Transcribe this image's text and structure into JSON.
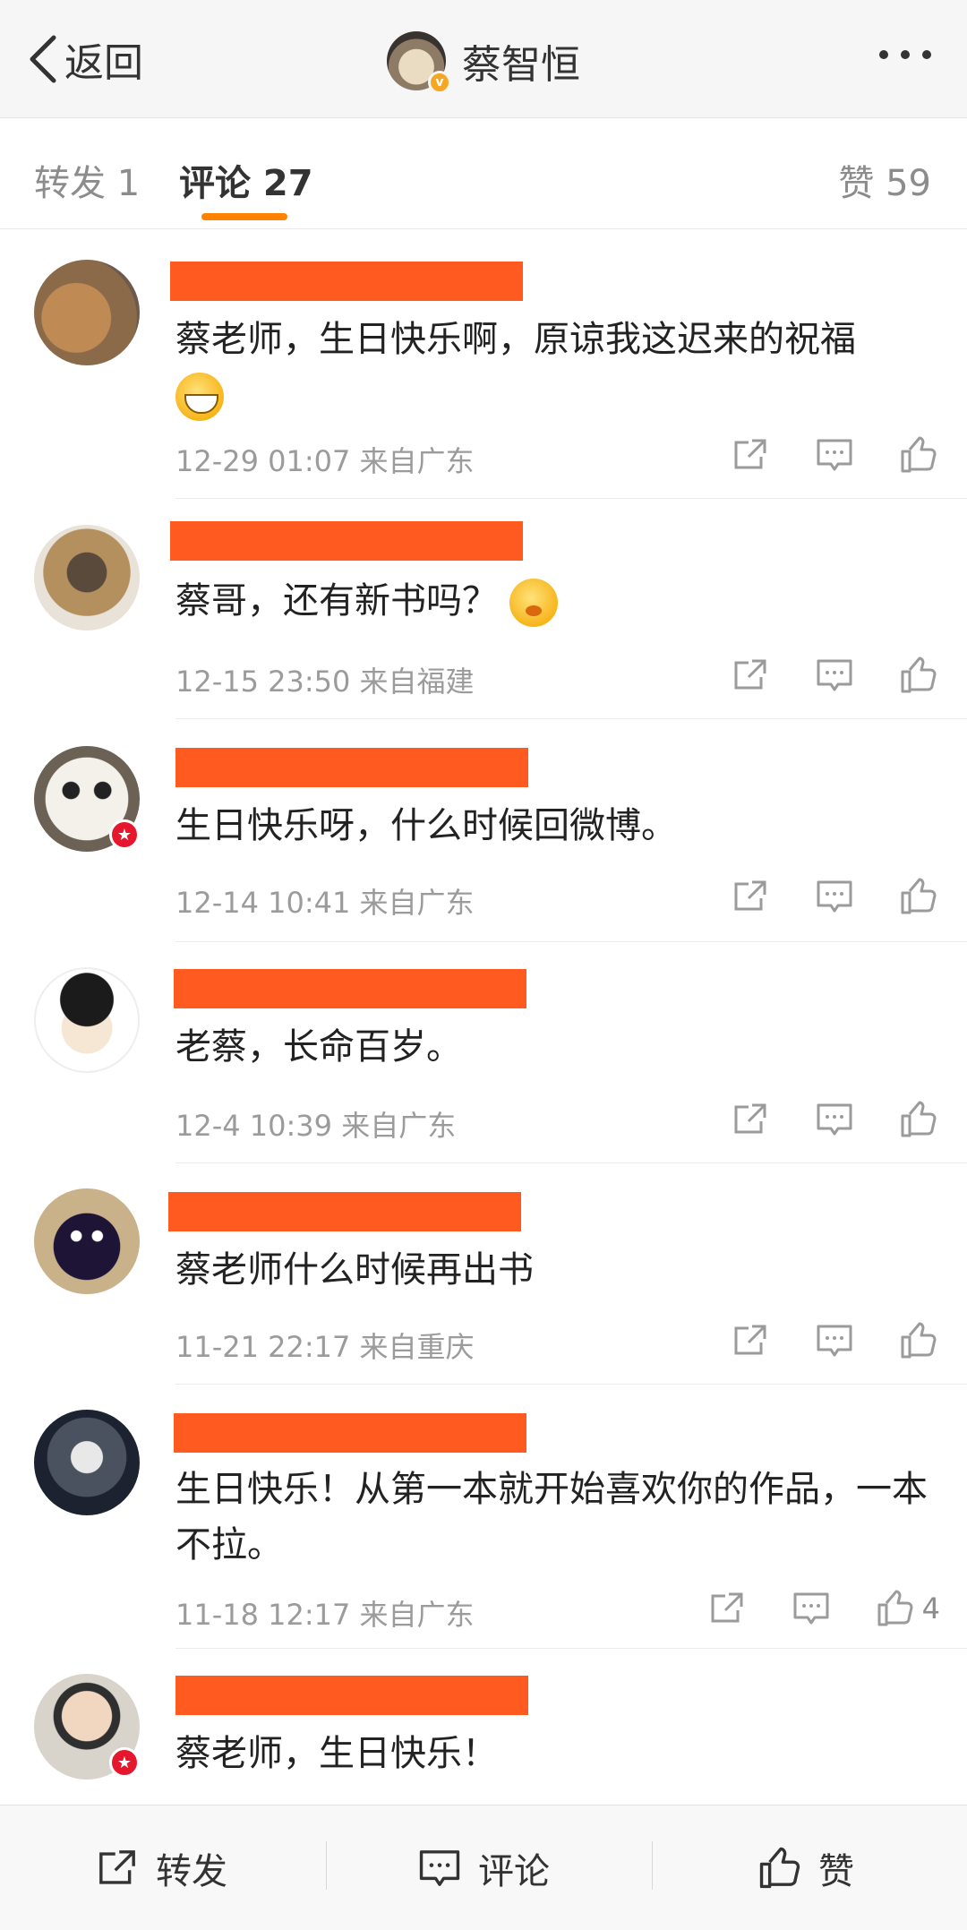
{
  "header": {
    "back_label": "返回",
    "title": "蔡智恒"
  },
  "tabs": {
    "repost": "转发 1",
    "comment": "评论 27",
    "like": "赞 59"
  },
  "comments": [
    {
      "text": "蔡老师，生日快乐啊，原谅我这迟来的祝福",
      "emoji": "grinning-emoji",
      "time": "12-29 01:07",
      "location": "来自广东"
    },
    {
      "text": "蔡哥，还有新书吗？",
      "emoji": "shushing-emoji",
      "time": "12-15 23:50",
      "location": "来自福建"
    },
    {
      "text": "生日快乐呀，什么时候回微博。",
      "time": "12-14 10:41",
      "location": "来自广东"
    },
    {
      "text": "老蔡，长命百岁。",
      "time": "12-4 10:39",
      "location": "来自广东"
    },
    {
      "text": "蔡老师什么时候再出书",
      "time": "11-21 22:17",
      "location": "来自重庆"
    },
    {
      "text": "生日快乐！从第一本就开始喜欢你的作品，一本不拉。",
      "time": "11-18 12:17",
      "location": "来自广东",
      "like_count": "4"
    },
    {
      "text": "蔡老师，生日快乐！"
    }
  ],
  "bottom_bar": {
    "repost": "转发",
    "comment": "评论",
    "like": "赞"
  },
  "colors": {
    "accent": "#ff8200",
    "redaction": "#ff5a1f",
    "badge_red": "#e6162d",
    "verified": "#f5a623"
  }
}
